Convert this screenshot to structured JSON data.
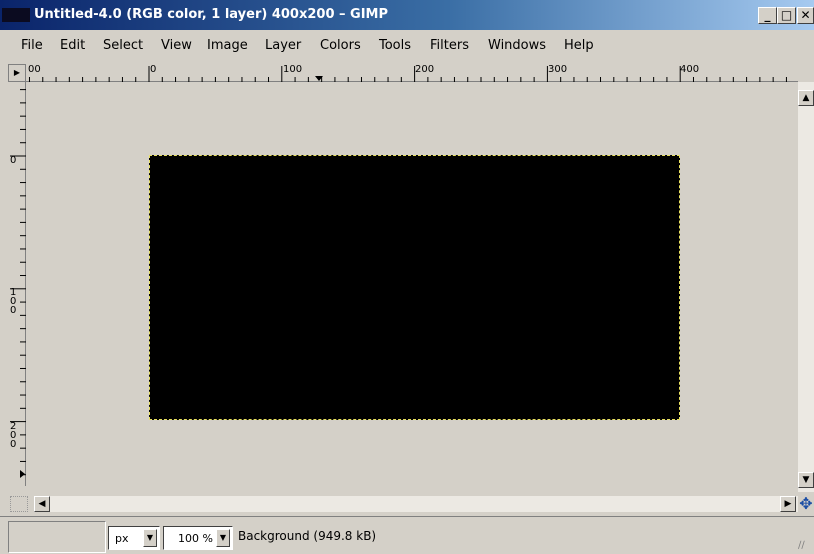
{
  "window": {
    "title": "Untitled-4.0 (RGB color, 1 layer) 400x200 – GIMP",
    "controls": {
      "minimize": "_",
      "maximize": "□",
      "close": "✕"
    }
  },
  "menu": {
    "file": "File",
    "edit": "Edit",
    "select": "Select",
    "view": "View",
    "image": "Image",
    "layer": "Layer",
    "colors": "Colors",
    "tools": "Tools",
    "filters": "Filters",
    "windows": "Windows",
    "help": "Help"
  },
  "rulers": {
    "corner_label": "00",
    "horizontal_labels": [
      "0",
      "100",
      "200",
      "300",
      "400"
    ],
    "vertical_labels": [
      "0",
      "100",
      "200"
    ]
  },
  "statusbar": {
    "unit": "px",
    "zoom": "100 %",
    "layer_info": "Background (949.8 kB)"
  },
  "icons": {
    "ruler_corner": "menu-arrow-icon",
    "quick_mask": "quick-mask-icon",
    "navigate": "navigate-icon"
  },
  "colors": {
    "canvas": "#000000",
    "selection_marching_ants": "#e8e060",
    "workspace": "#d4d0c8"
  }
}
